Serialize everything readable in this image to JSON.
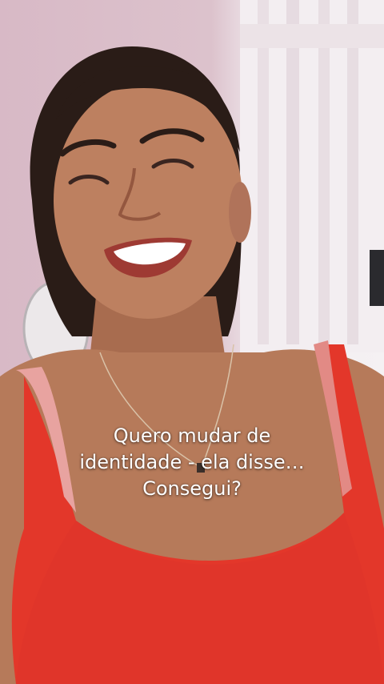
{
  "video": {
    "caption_lines": [
      "Quero mudar de",
      "identidade - ela disse…",
      "Consegui?"
    ]
  },
  "colors": {
    "wall": "#d9bfc9",
    "fence": "#f4f0f2",
    "skin": "#b67a5a",
    "hair": "#2a1c17",
    "top": "#e3372a",
    "strap": "#e8a3a0",
    "caption": "#ffffff"
  }
}
